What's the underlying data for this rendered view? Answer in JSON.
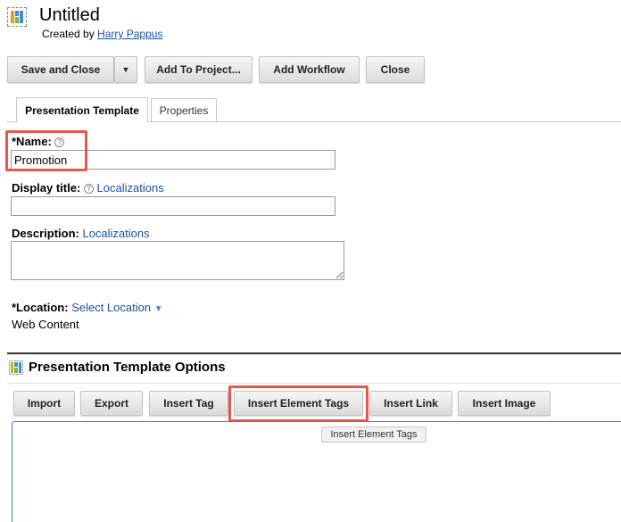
{
  "header": {
    "title": "Untitled",
    "created_prefix": "Created by",
    "author": "Harry Pappus"
  },
  "toolbar": {
    "save_close": "Save and Close",
    "add_to_project": "Add To Project...",
    "add_workflow": "Add Workflow",
    "close": "Close"
  },
  "tabs": [
    {
      "label": "Presentation Template",
      "active": true
    },
    {
      "label": "Properties",
      "active": false
    }
  ],
  "form": {
    "name_label": "*Name:",
    "name_value": "Promotion",
    "display_title_label": "Display title:",
    "description_label": "Description:",
    "localizations_link": "Localizations",
    "location_label": "*Location:",
    "select_location_link": "Select Location",
    "location_value": "Web Content"
  },
  "options": {
    "title": "Presentation Template Options",
    "buttons": [
      "Import",
      "Export",
      "Insert Tag",
      "Insert Element Tags",
      "Insert Link",
      "Insert Image"
    ],
    "tooltip": "Insert Element Tags"
  },
  "colors": {
    "highlight": "#e8574a",
    "link": "#1e50a0",
    "editor_border": "#3a7fd1"
  }
}
